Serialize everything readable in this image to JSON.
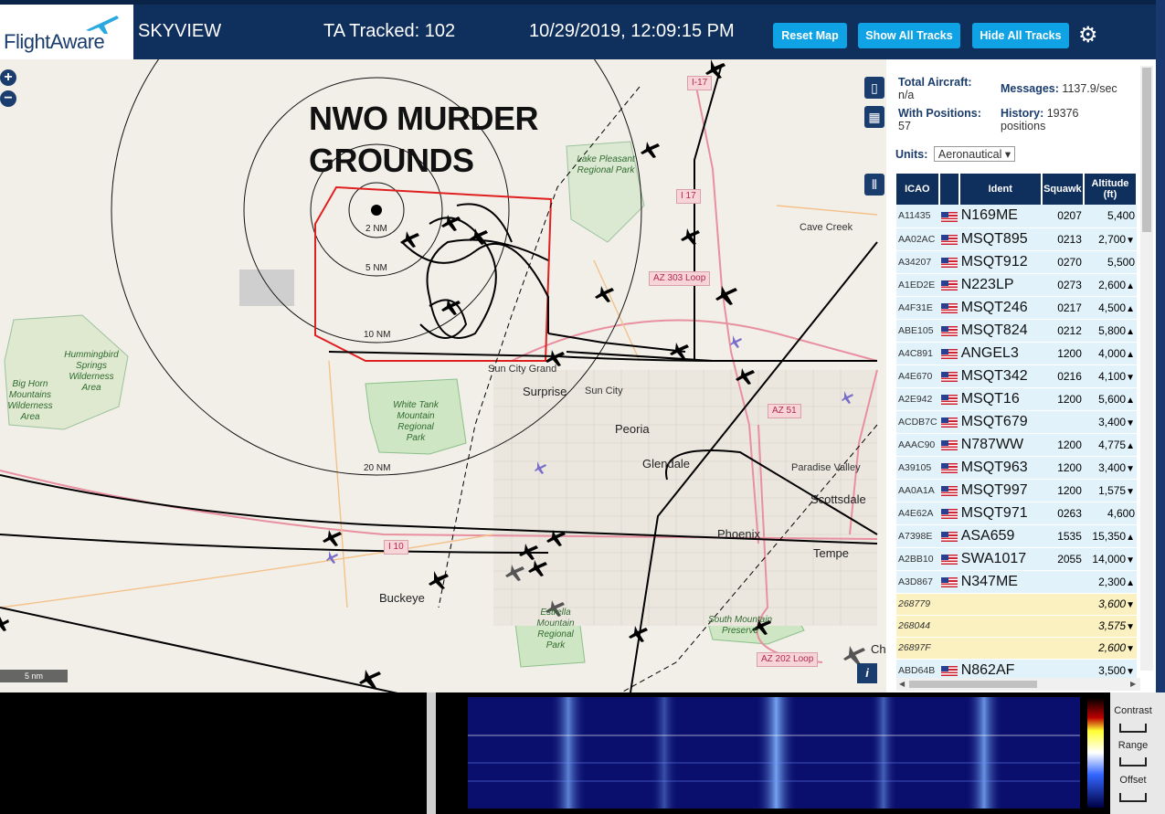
{
  "header": {
    "brand": "FlightAware",
    "product": "SKYVIEW",
    "tracked": "TA Tracked: 102",
    "datetime": "10/29/2019, 12:09:15 PM",
    "reset_label": "Reset Map",
    "show_label": "Show All Tracks",
    "hide_label": "Hide All Tracks",
    "gear_icon": "gear-icon"
  },
  "map": {
    "overlay_line1": "NWO MURDER",
    "overlay_line2": "GROUNDS",
    "range_labels": [
      "2 NM",
      "5 NM",
      "10 NM",
      "20 NM"
    ],
    "scale": "5 nm",
    "cities": [
      "Surprise",
      "Sun City",
      "Sun City Grand",
      "Peoria",
      "Glendale",
      "Phoenix",
      "Tempe",
      "Scottsdale",
      "Paradise Valley",
      "Buckeye",
      "Cave Creek",
      "Ch"
    ],
    "parks": {
      "lake_pleasant": "Lake Pleasant Regional Park",
      "hummingbird": "Hummingbird Springs Wilderness Area",
      "big_horn": "Big Horn Mountains Wilderness Area",
      "white_tank": "White Tank Mountain Regional Park",
      "estrella": "Estrella Mountain Regional Park",
      "south_mountain": "South Mountain Preserve"
    },
    "shields": [
      "I-17",
      "I 17",
      "AZ 303 Loop",
      "AZ 51",
      "I 10",
      "AZ 202 Loop"
    ],
    "info_label": "i"
  },
  "panel": {
    "total_label": "Total Aircraft:",
    "total_value": "n/a",
    "messages_label": "Messages:",
    "messages_value": "1137.9/sec",
    "withpos_label": "With Positions:",
    "withpos_value": "57",
    "history_label": "History:",
    "history_value": "19376",
    "history_unit": "positions",
    "units_label": "Units:",
    "units_value": "Aeronautical",
    "columns": [
      "ICAO",
      "",
      "Ident",
      "Squawk",
      "Altitude (ft)"
    ],
    "rows": [
      {
        "icao": "A11435",
        "ident": "N169ME",
        "squawk": "0207",
        "alt": "5,400",
        "trend": ""
      },
      {
        "icao": "AA02AC",
        "ident": "MSQT895",
        "squawk": "0213",
        "alt": "2,700",
        "trend": "▼"
      },
      {
        "icao": "A34207",
        "ident": "MSQT912",
        "squawk": "0270",
        "alt": "5,500",
        "trend": ""
      },
      {
        "icao": "A1ED2E",
        "ident": "N223LP",
        "squawk": "0273",
        "alt": "2,600",
        "trend": "▲"
      },
      {
        "icao": "A4F31E",
        "ident": "MSQT246",
        "squawk": "0217",
        "alt": "4,500",
        "trend": "▲"
      },
      {
        "icao": "ABE105",
        "ident": "MSQT824",
        "squawk": "0212",
        "alt": "5,800",
        "trend": "▲"
      },
      {
        "icao": "A4C891",
        "ident": "ANGEL3",
        "squawk": "1200",
        "alt": "4,000",
        "trend": "▲"
      },
      {
        "icao": "A4E670",
        "ident": "MSQT342",
        "squawk": "0216",
        "alt": "4,100",
        "trend": "▼"
      },
      {
        "icao": "A2E942",
        "ident": "MSQT16",
        "squawk": "1200",
        "alt": "5,600",
        "trend": "▲"
      },
      {
        "icao": "ACDB7C",
        "ident": "MSQT679",
        "squawk": "",
        "alt": "3,400",
        "trend": "▼"
      },
      {
        "icao": "AAAC90",
        "ident": "N787WW",
        "squawk": "1200",
        "alt": "4,775",
        "trend": "▲"
      },
      {
        "icao": "A39105",
        "ident": "MSQT963",
        "squawk": "1200",
        "alt": "3,400",
        "trend": "▼"
      },
      {
        "icao": "AA0A1A",
        "ident": "MSQT997",
        "squawk": "1200",
        "alt": "1,575",
        "trend": "▼"
      },
      {
        "icao": "A4E62A",
        "ident": "MSQT971",
        "squawk": "0263",
        "alt": "4,600",
        "trend": ""
      },
      {
        "icao": "A7398E",
        "ident": "ASA659",
        "squawk": "1535",
        "alt": "15,350",
        "trend": "▲"
      },
      {
        "icao": "A2BB10",
        "ident": "SWA1017",
        "squawk": "2055",
        "alt": "14,000",
        "trend": "▼"
      },
      {
        "icao": "A3D867",
        "ident": "N347ME",
        "squawk": "",
        "alt": "2,300",
        "trend": "▲"
      },
      {
        "icao": "268779",
        "ident": "",
        "squawk": "",
        "alt": "3,600",
        "trend": "▼",
        "nopos": true
      },
      {
        "icao": "268044",
        "ident": "",
        "squawk": "",
        "alt": "3,575",
        "trend": "▼",
        "nopos": true
      },
      {
        "icao": "26897F",
        "ident": "",
        "squawk": "",
        "alt": "2,600",
        "trend": "▼",
        "nopos": true
      },
      {
        "icao": "ABD64B",
        "ident": "N862AF",
        "squawk": "",
        "alt": "3,500",
        "trend": "▼"
      }
    ]
  },
  "sdr": {
    "contrast": "Contrast",
    "range": "Range",
    "offset": "Offset"
  },
  "colors": {
    "header_bg": "#0f2f5c",
    "button_bg": "#0fa3e6",
    "row_bg": "#e1f2fb",
    "nopos_bg": "#fbf0c0",
    "range_box": "#e02020"
  }
}
